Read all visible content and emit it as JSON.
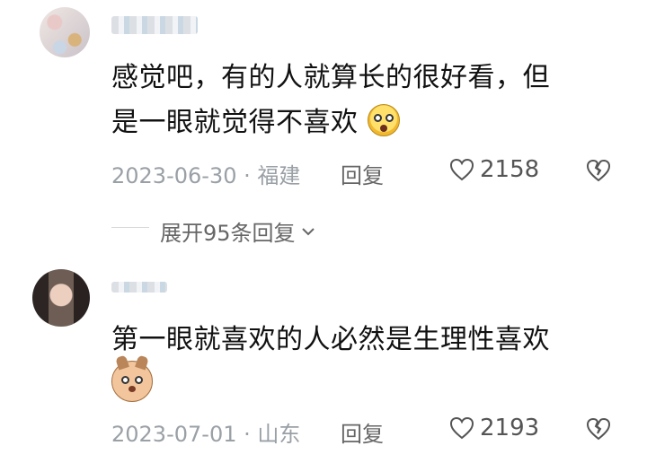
{
  "comments": [
    {
      "text_line1": "感觉吧，有的人就算长的很好看，但",
      "text_line2": "是一眼就觉得不喜欢",
      "date": "2023-06-30",
      "location": "福建",
      "reply_label": "回复",
      "likes": "2158",
      "expand_label": "展开95条回复"
    },
    {
      "text_line1": "第一眼就喜欢的人必然是生理性喜欢",
      "date": "2023-07-01",
      "location": "山东",
      "reply_label": "回复",
      "likes": "2193"
    }
  ],
  "separator": " · "
}
